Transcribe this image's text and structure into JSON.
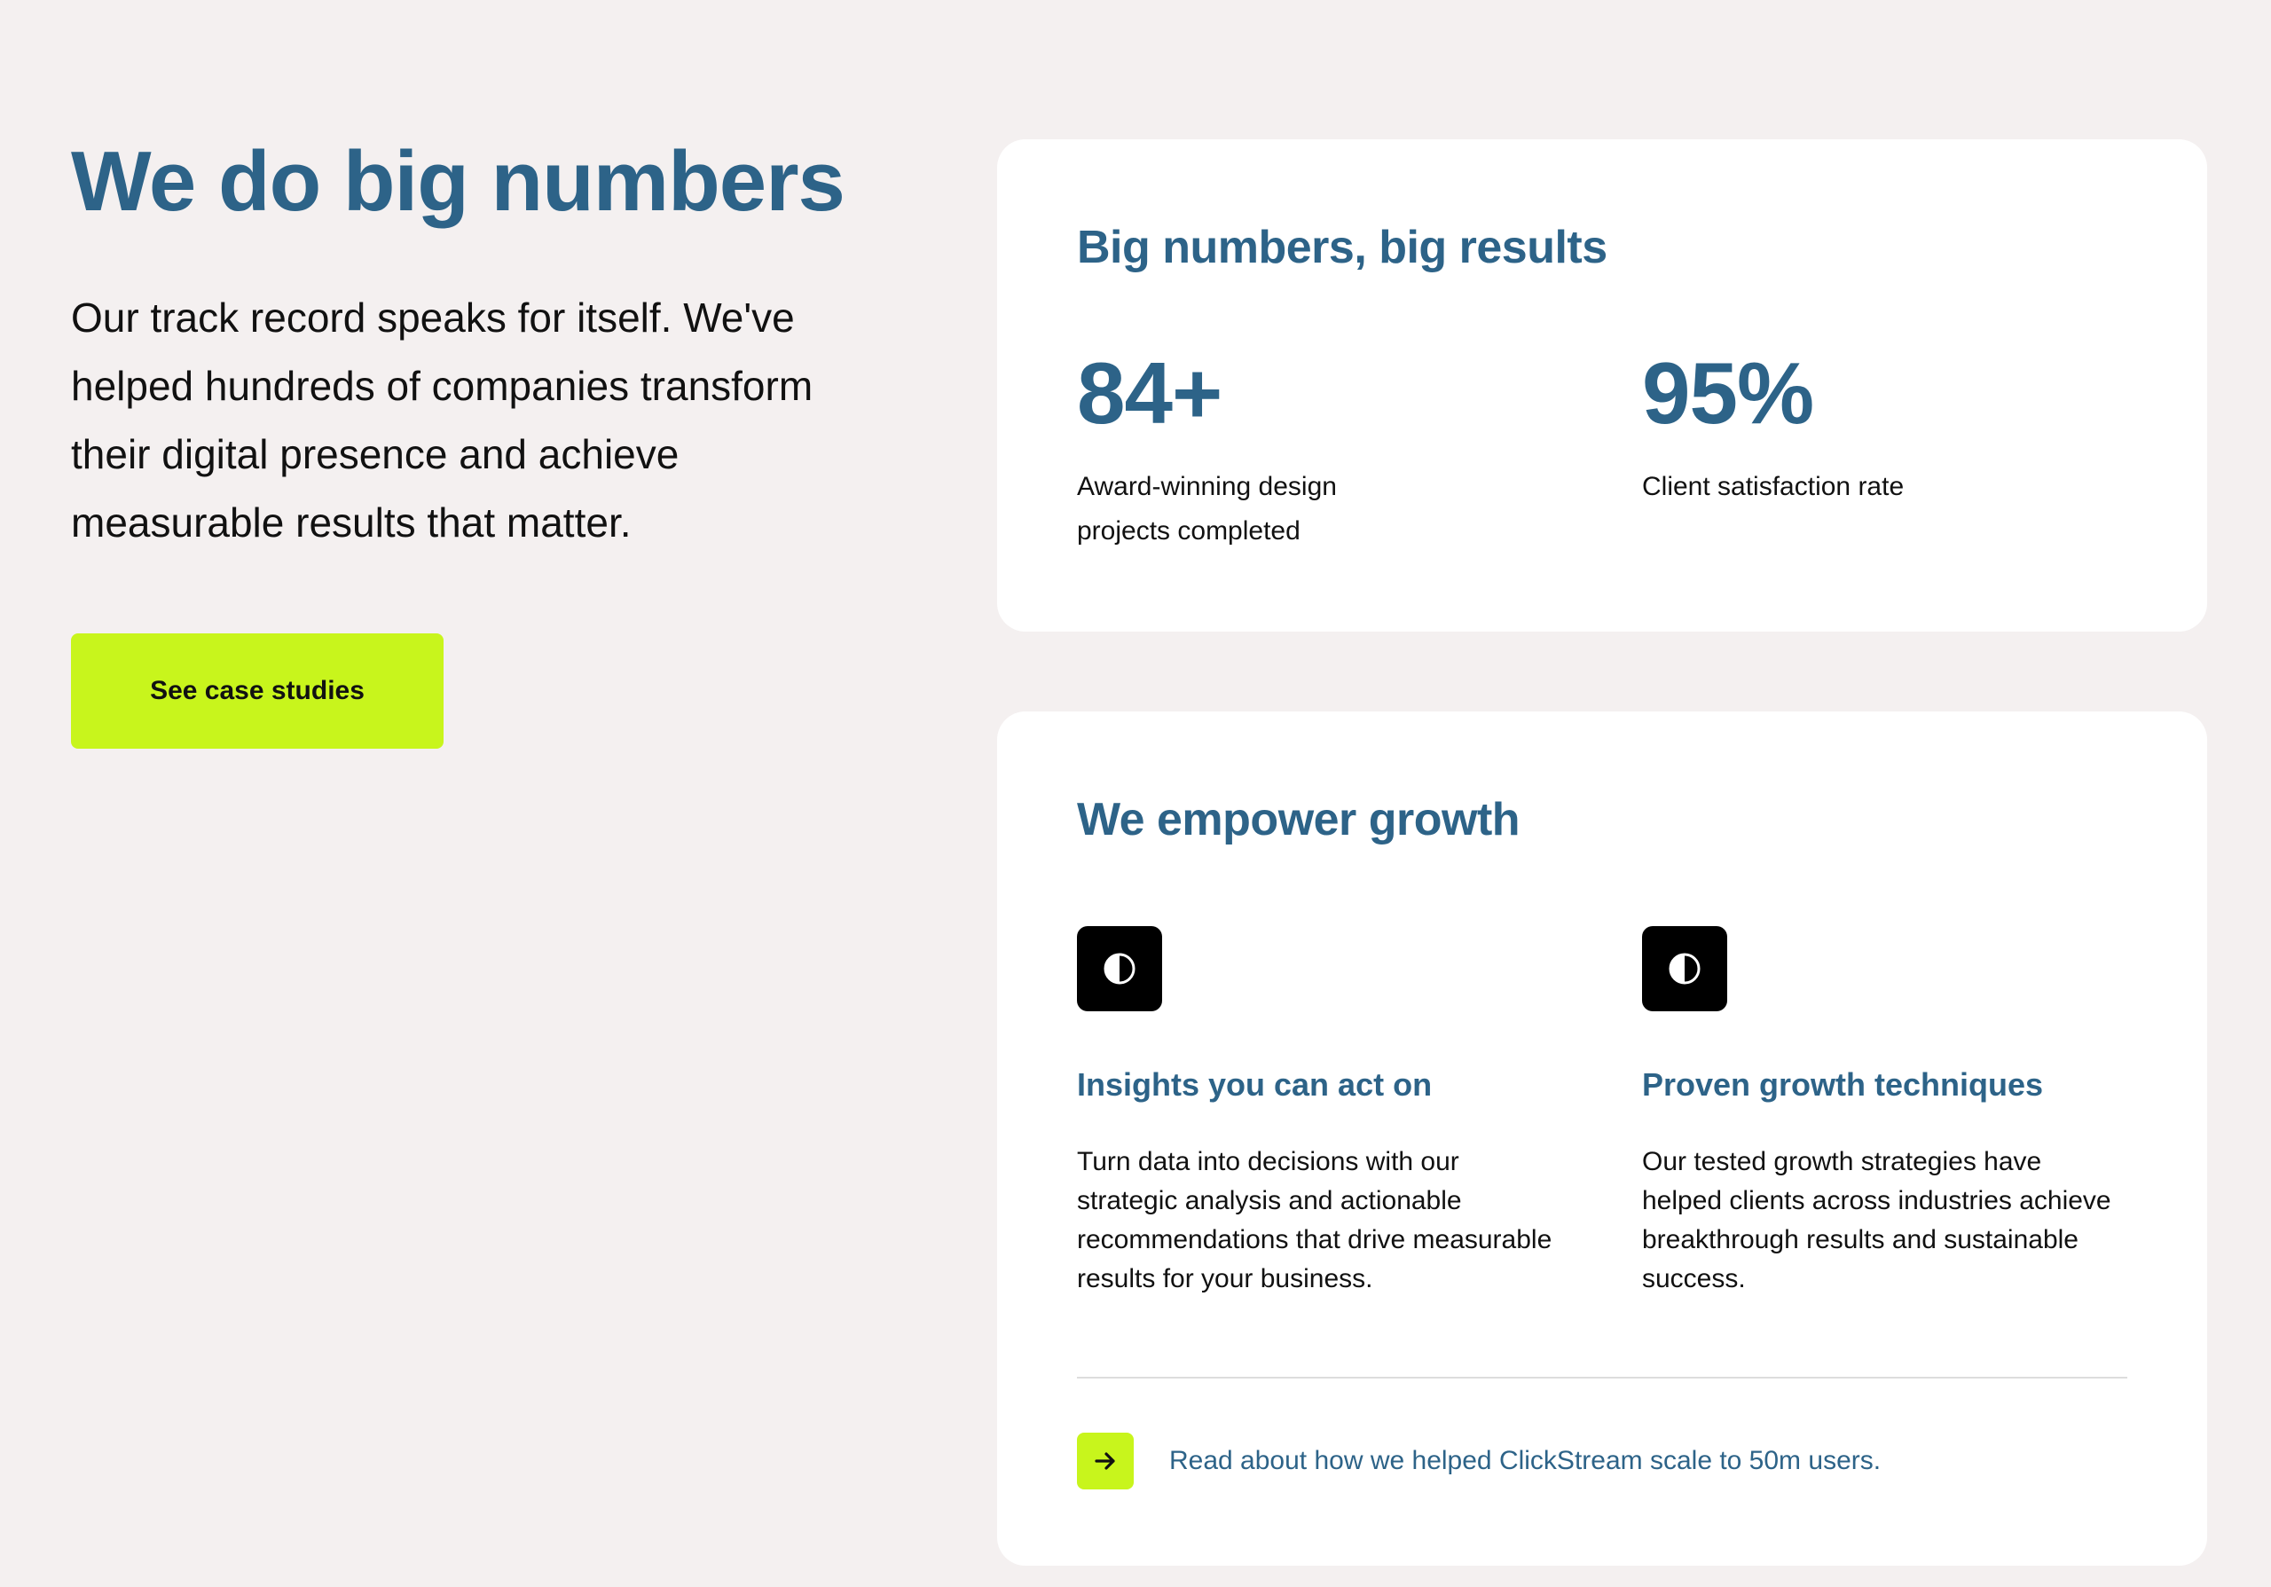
{
  "hero": {
    "title": "We do big numbers",
    "body": "Our track record speaks for itself. We've helped hundreds of companies transform their digital presence and achieve measurable results that matter.",
    "cta_label": "See case studies"
  },
  "results_card": {
    "title": "Big numbers, big results",
    "stats": [
      {
        "value": "84+",
        "label": "Award-winning design projects completed"
      },
      {
        "value": "95%",
        "label": "Client satisfaction rate"
      }
    ]
  },
  "growth_card": {
    "title": "We empower growth",
    "features": [
      {
        "icon": "half-circle-icon",
        "title": "Insights you can act on",
        "text": "Turn data into decisions with our strategic analysis and actionable recommendations that drive measurable results for your business."
      },
      {
        "icon": "half-circle-icon",
        "title": "Proven growth techniques",
        "text": "Our tested growth strategies have helped clients across industries achieve breakthrough results and sustainable success."
      }
    ],
    "link_icon": "arrow-right-icon",
    "link_text": "Read about how we helped ClickStream scale to 50m users."
  },
  "colors": {
    "background": "#f4f0f0",
    "brand_blue": "#2d6388",
    "accent_lime": "#c8f51c",
    "card": "#ffffff",
    "icon_tile": "#000000"
  }
}
